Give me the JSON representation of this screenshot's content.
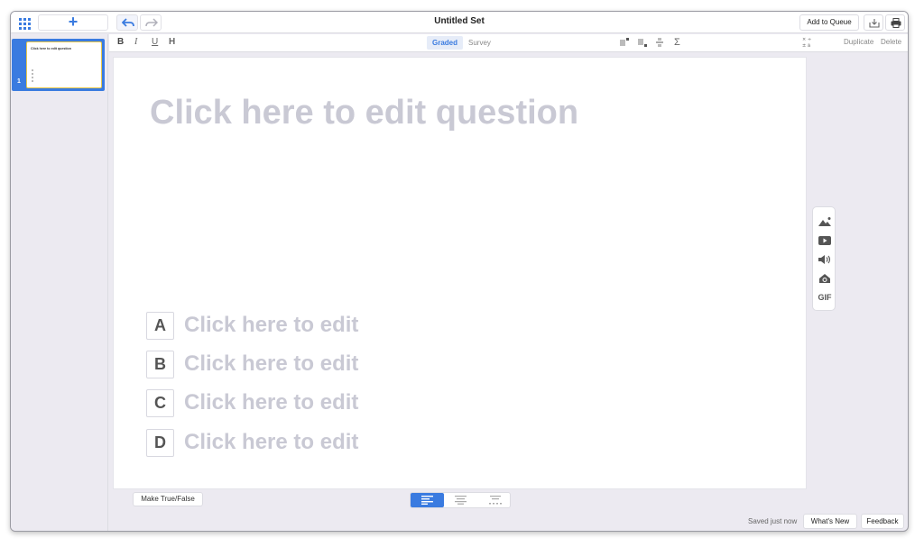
{
  "header": {
    "title": "Untitled Set",
    "add_slide_label": "+",
    "add_to_queue_label": "Add to Queue"
  },
  "sidebar": {
    "slides": [
      {
        "number": "1",
        "preview_text": "Click here to edit question"
      }
    ]
  },
  "format_toolbar": {
    "bold": "B",
    "italic": "I",
    "underline": "U",
    "heading": "H",
    "tabs": [
      "Graded",
      "Survey"
    ],
    "active_tab": "Graded",
    "sigma": "Σ",
    "duplicate_label": "Duplicate",
    "delete_label": "Delete"
  },
  "canvas": {
    "question_placeholder": "Click here to edit question",
    "answers": [
      {
        "letter": "A",
        "text": "Click here to edit"
      },
      {
        "letter": "B",
        "text": "Click here to edit"
      },
      {
        "letter": "C",
        "text": "Click here to edit"
      },
      {
        "letter": "D",
        "text": "Click here to edit"
      }
    ]
  },
  "media_panel": {
    "items": [
      "image-icon",
      "video-icon",
      "audio-icon",
      "web-icon",
      "gif-icon"
    ],
    "gif_label": "GIF"
  },
  "footer": {
    "make_true_false_label": "Make True/False",
    "saved_status": "Saved just now",
    "whats_new_label": "What's New",
    "feedback_label": "Feedback"
  },
  "colors": {
    "accent": "#3a7be0",
    "placeholder_text": "#c9c9d4",
    "background": "#eceaf1"
  }
}
